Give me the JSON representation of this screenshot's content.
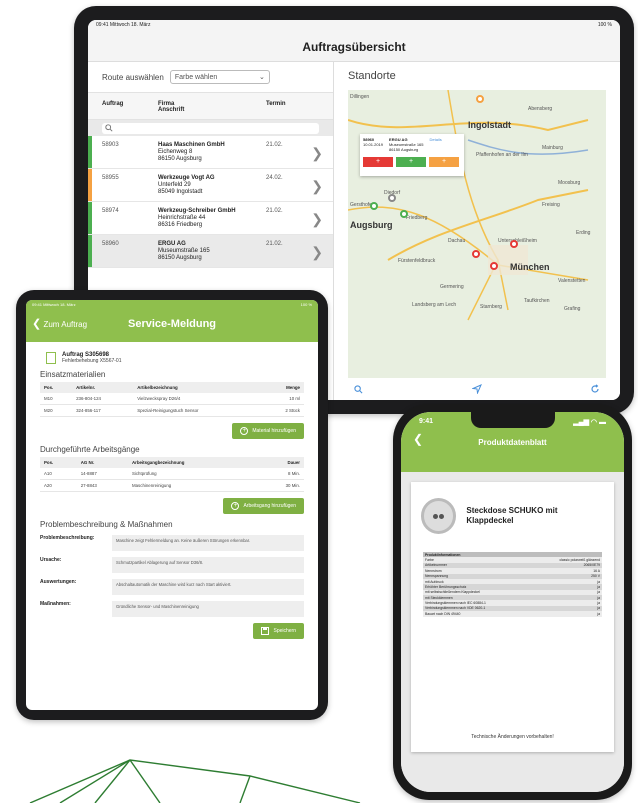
{
  "big_tablet": {
    "status_left": "09:41  Mittwoch 18. März",
    "status_right": "100 %",
    "title": "Auftragsübersicht",
    "route_label": "Route auswählen",
    "color_select": "Farbe wählen",
    "columns": {
      "order": "Auftrag",
      "company": "Firma",
      "address": "Anschrift",
      "date": "Termin"
    },
    "rows": [
      {
        "order": "58903",
        "name": "Haas Maschinen GmbH",
        "street": "Eichenweg 8",
        "city": "86150 Augsburg",
        "date": "21.02.",
        "color": "#4caf50"
      },
      {
        "order": "58955",
        "name": "Werkzeuge Vogt AG",
        "street": "Unterfeld 29",
        "city": "85049 Ingolstadt",
        "date": "24.02.",
        "color": "#f5a142"
      },
      {
        "order": "58974",
        "name": "Werkzeug-Schreiber GmbH",
        "street": "Heinrichstraße 44",
        "city": "86316 Friedberg",
        "date": "21.02.",
        "color": "#4caf50"
      },
      {
        "order": "58960",
        "name": "ERGU AG",
        "street": "Museumstraße 165",
        "city": "86150 Augsburg",
        "date": "21.02.",
        "color": "#4caf50"
      }
    ],
    "map_title": "Standorte",
    "popup": {
      "order": "58960",
      "date": "10.01.2019",
      "name": "ERGU AG",
      "street": "Museumstraße 165",
      "city": "86150 Augsburg",
      "details": "Details",
      "btn": "+"
    },
    "map_labels": {
      "ingolstadt": "Ingolstadt",
      "augsburg": "Augsburg",
      "muenchen": "München",
      "freising": "Freising",
      "dachau": "Dachau",
      "germering": "Germering",
      "landsberg": "Landsberg am Lech",
      "starnberg": "Starnberg",
      "erding": "Erding",
      "moosburg": "Moosburg",
      "abensberg": "Abensberg",
      "mainburg": "Mainburg",
      "pfaffenhofen": "Pfaffenhofen an der Ilm",
      "fuerstenfeldbruck": "Fürstenfeldbruck",
      "valentin": "Valenstetten",
      "unterschleissheim": "Unterschleißheim",
      "taufkirchen": "Taufkirchen",
      "grafing": "Grafing",
      "gersthofen": "Gersthofen",
      "friedberg": "Friedberg",
      "diedorf": "Diedorf",
      "dillingen": "Dillingen"
    }
  },
  "mid_tablet": {
    "status_left": "09:41  Mittwoch 18. März",
    "status_right": "100 %",
    "back": "Zum Auftrag",
    "title": "Service-Meldung",
    "order_no": "Auftrag S305698",
    "order_sub": "Fehlerbehebung X5567-01",
    "materials_title": "Einsatzmaterialien",
    "materials_cols": [
      "Pos.",
      "Artikelnr.",
      "Artikelbezeichnung",
      "Menge"
    ],
    "materials": [
      [
        "M10",
        "236-804-124",
        "Vielzweckspray D26/4",
        "10 ml"
      ],
      [
        "M20",
        "324-856-117",
        "Spezial-Reinigungstuch Sensor",
        "2 Stück"
      ]
    ],
    "add_material": "Material hinzufügen",
    "work_title": "Durchgeführte Arbeitsgänge",
    "work_cols": [
      "Pos.",
      "AG Nr.",
      "Arbeitsgangbezeichnung",
      "Dauer"
    ],
    "work": [
      [
        "A10",
        "14-8887",
        "Sichtprüfung",
        "8 Min."
      ],
      [
        "A20",
        "27-8843",
        "Maschinenreinigung",
        "30 Min."
      ]
    ],
    "add_work": "Arbeitsgang hinzufügen",
    "problem_title": "Problembeschreibung & Maßnahmen",
    "problem_rows": [
      {
        "label": "Problembeschreibung:",
        "text": "Maschine zeigt Fehlermeldung an. Keine äußeren Störungen erkennbar."
      },
      {
        "label": "Ursache:",
        "text": "Schmutzpartikel Ablagerung auf Sensor D36/8."
      },
      {
        "label": "Auswertungen:",
        "text": "Abschaltautomatik der Maschine wird kurz nach Start aktiviert."
      },
      {
        "label": "Maßnahmen:",
        "text": "Gründliche Sensor- und Maschinenreinigung"
      }
    ],
    "save": "Speichern"
  },
  "phone": {
    "time": "9:41",
    "title": "Produktdatenblatt",
    "product": "Steckdose SCHUKO mit Klappdeckel",
    "spec_header": "Produktinformationen",
    "specs": [
      [
        "Farbe",
        "classic polarweiß glänzend"
      ],
      [
        "Artikelnummer",
        "2065/0E79"
      ],
      [
        "Nennstrom",
        "16 A"
      ],
      [
        "Nennspannung",
        "250 V"
      ],
      [
        "mit Aufdruck",
        "ja"
      ],
      [
        "Erhöhter Berührungsschutz",
        "ja"
      ],
      [
        "mit selbstschließendem Klappdeckel",
        "ja"
      ],
      [
        "mit Steckklemmen",
        "ja"
      ],
      [
        "Verbindungsklemmen nach IEC 60884-1",
        "ja"
      ],
      [
        "Verbindungsklemmen nach VDE 0620-1",
        "ja"
      ],
      [
        "Bauart nach DIN 49440",
        "ja"
      ]
    ],
    "footer": "Technische Änderungen vorbehalten!"
  },
  "colors": {
    "green": "#8fbf4d",
    "button_green": "#7fb043",
    "red": "#e53935",
    "orange": "#f5a142",
    "blue": "#4a90d9"
  }
}
